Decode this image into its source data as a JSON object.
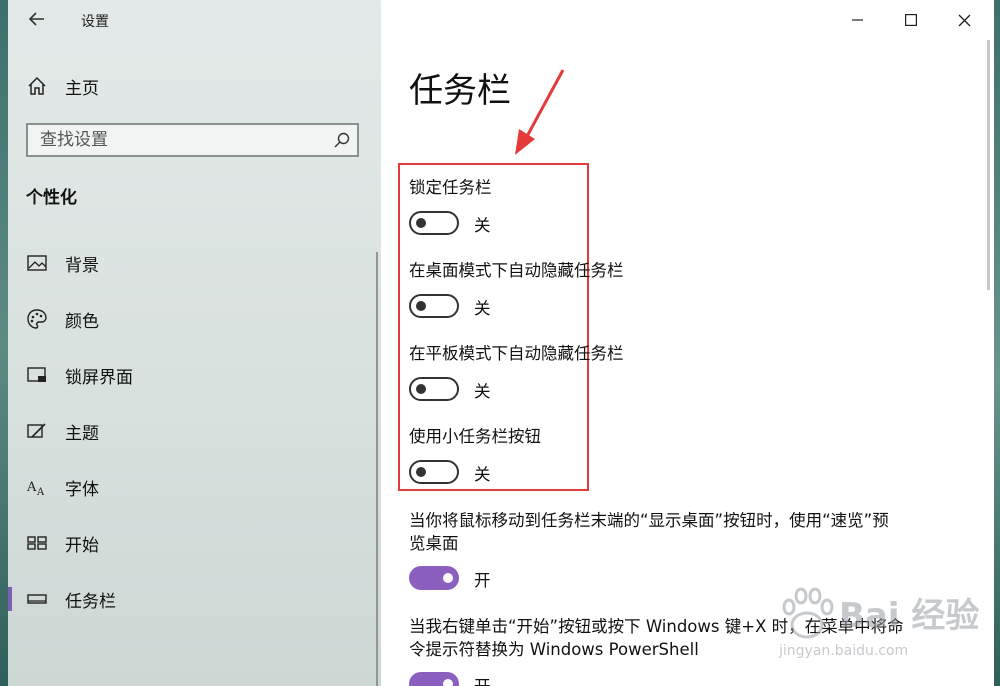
{
  "app": {
    "title": "设置"
  },
  "sidebar": {
    "home_label": "主页",
    "search_placeholder": "查找设置",
    "section_title": "个性化",
    "items": [
      {
        "label": "背景",
        "icon": "image-icon"
      },
      {
        "label": "颜色",
        "icon": "palette-icon"
      },
      {
        "label": "锁屏界面",
        "icon": "lock-screen-icon"
      },
      {
        "label": "主题",
        "icon": "theme-brush-icon"
      },
      {
        "label": "字体",
        "icon": "font-icon"
      },
      {
        "label": "开始",
        "icon": "start-grid-icon"
      },
      {
        "label": "任务栏",
        "icon": "taskbar-icon",
        "active": true
      }
    ]
  },
  "main": {
    "title": "任务栏",
    "settings": [
      {
        "label": "锁定任务栏",
        "state": "关",
        "on": false
      },
      {
        "label": "在桌面模式下自动隐藏任务栏",
        "state": "关",
        "on": false
      },
      {
        "label": "在平板模式下自动隐藏任务栏",
        "state": "关",
        "on": false
      },
      {
        "label": "使用小任务栏按钮",
        "state": "关",
        "on": false
      },
      {
        "label_line1": "当你将鼠标移动到任务栏末端的“显示桌面”按钮时，使用“速览”预",
        "label_line2": "览桌面",
        "state": "开",
        "on": true
      },
      {
        "label_line1": "当我右键单击“开始”按钮或按下 Windows 键+X 时，在菜单中将命",
        "label_line2": "令提示符替换为 Windows PowerShell",
        "state": "开",
        "on": true
      }
    ]
  },
  "colors": {
    "accent": "#8a5fbf",
    "highlight": "#e53a3a",
    "arrow": "#e53a3a"
  },
  "watermark": {
    "text": "Bai 经验",
    "url": "jingyan.baidu.com"
  }
}
